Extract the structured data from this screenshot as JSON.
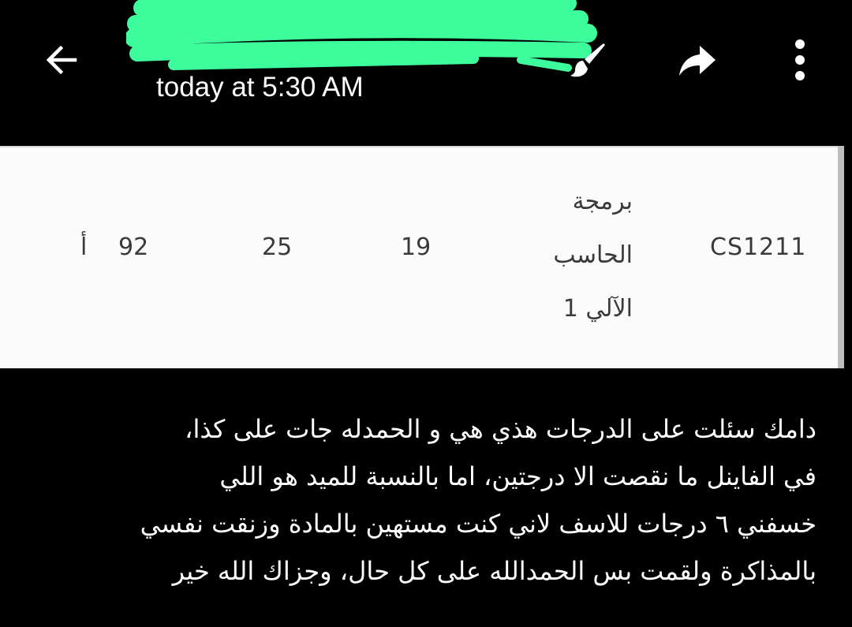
{
  "header": {
    "timestamp": "today at 5:30 AM",
    "redaction_color": "#3dfc9c",
    "icons": {
      "back": "arrow-left-icon",
      "edit": "paint-brush-icon",
      "share": "share-arrow-icon",
      "more": "more-vertical-icon"
    }
  },
  "grade_row": {
    "course_code": "CS1211",
    "course_name_lines": [
      "برمجة",
      "الحاسب",
      "الآلي 1"
    ],
    "midterm": "19",
    "final": "25",
    "total": "92",
    "letter_grade": "أ"
  },
  "message": {
    "lines": [
      "دامك سئلت على الدرجات هذي هي و الحمدله جات على كذا،",
      "في الفاينل ما نقصت الا درجتين، اما بالنسبة للميد هو اللي",
      "خسفني ٦ درجات للاسف لاني كنت مستهين بالمادة وزنقت نفسي",
      "بالمذاكرة ولقمت بس الحمدالله على كل حال، وجزاك الله خير"
    ]
  },
  "colors": {
    "background": "#000000",
    "card": "#fbfbfb",
    "card_text": "#3a3a3a",
    "text": "#ffffff"
  }
}
